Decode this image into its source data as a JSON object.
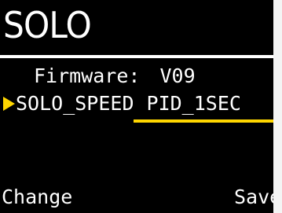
{
  "title": "SOLO",
  "rows": [
    {
      "label": "Firmware:",
      "value": "V09"
    },
    {
      "label": "SOLO_SPEED",
      "value": "PID_1SEC"
    }
  ],
  "footer": {
    "left_action": "Change",
    "right_action": "Save"
  },
  "colors": {
    "background": "#000000",
    "text": "#ffffff",
    "accent": "#ffd600",
    "page": "#f4f4f4"
  },
  "icons": {
    "selection_cursor": "triangle-right-icon"
  }
}
